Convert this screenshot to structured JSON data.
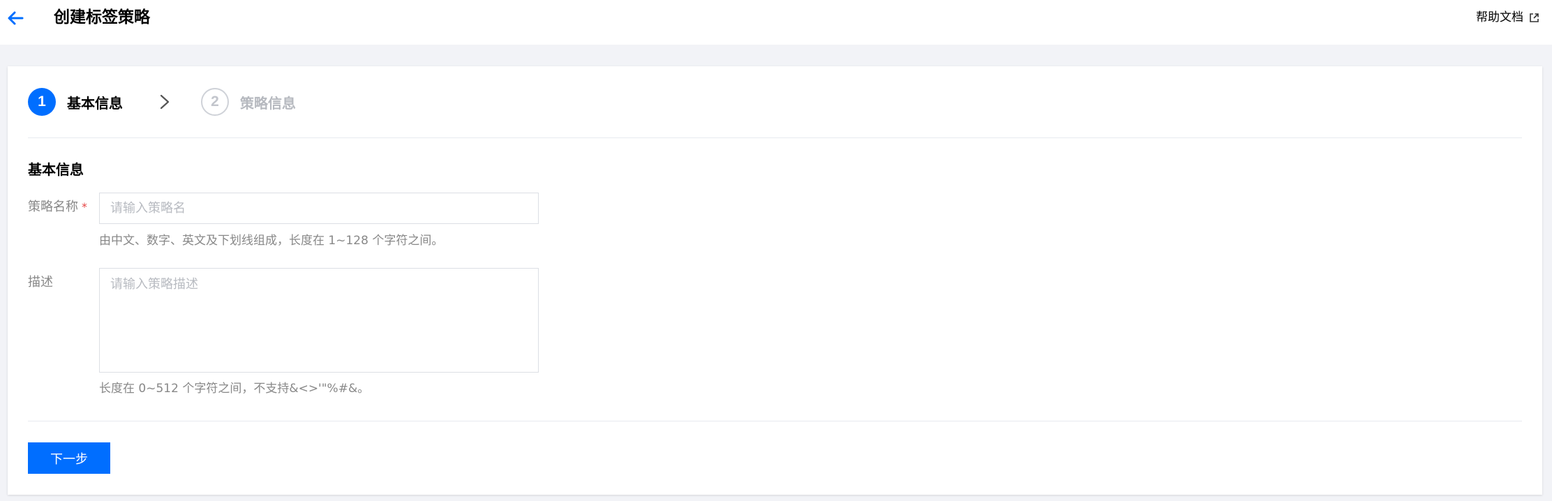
{
  "header": {
    "title": "创建标签策略",
    "help_label": "帮助文档",
    "back_icon": "arrow-left-icon",
    "help_icon": "external-link-icon"
  },
  "steps": [
    {
      "number": "1",
      "label": "基本信息",
      "active": true
    },
    {
      "number": "2",
      "label": "策略信息",
      "active": false
    }
  ],
  "form": {
    "section_title": "基本信息",
    "name": {
      "label": "策略名称",
      "required_mark": "*",
      "placeholder": "请输入策略名",
      "value": "",
      "hint": "由中文、数字、英文及下划线组成，长度在 1~128 个字符之间。"
    },
    "description": {
      "label": "描述",
      "placeholder": "请输入策略描述",
      "value": "",
      "hint": "长度在 0~512 个字符之间，不支持&<>'\"%#&。"
    },
    "next_button": "下一步"
  },
  "colors": {
    "accent": "#006eff",
    "required": "#e54545",
    "page_bg": "#f2f3f7"
  }
}
